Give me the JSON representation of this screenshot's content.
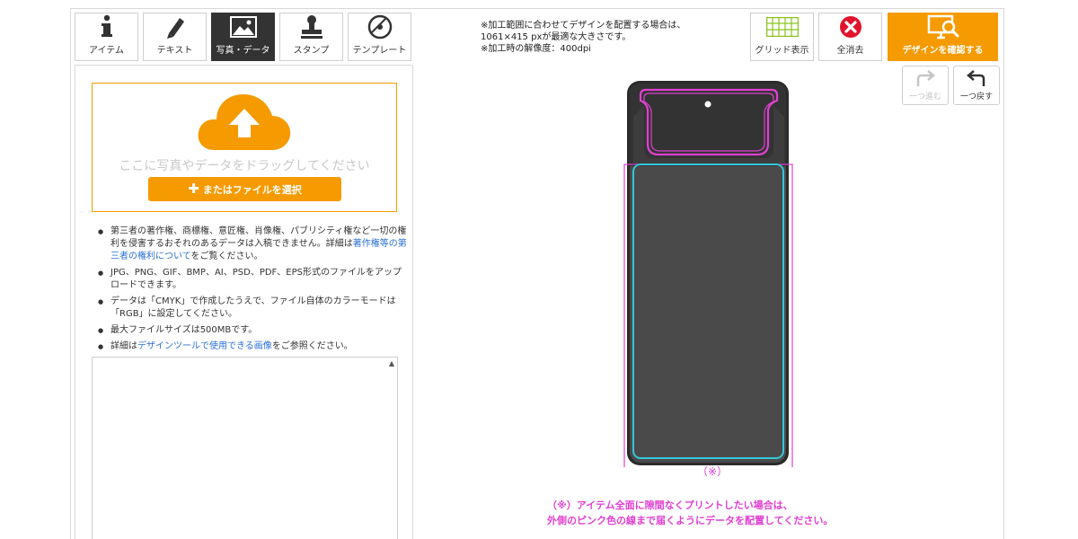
{
  "tabs": [
    {
      "label": "アイテム",
      "icon": "info-icon"
    },
    {
      "label": "テキスト",
      "icon": "pen-icon"
    },
    {
      "label": "写真・データ",
      "icon": "image-icon"
    },
    {
      "label": "スタンプ",
      "icon": "stamp-icon"
    },
    {
      "label": "テンプレート",
      "icon": "template-icon"
    }
  ],
  "upload": {
    "drop_text": "ここに写真やデータをドラッグしてください",
    "select_label": "またはファイルを選択"
  },
  "notes": {
    "n1_a": "第三者の著作権、商標権、意匠権、肖像権、パブリシティ権など一切の権利を侵害するおそれのあるデータは入稿できません。詳細は",
    "n1_link": "著作権等の第三者の権利について",
    "n1_b": "をご覧ください。",
    "n2": "JPG、PNG、GIF、BMP、AI、PSD、PDF、EPS形式のファイルをアップロードできます。",
    "n3": "データは「CMYK」で作成したうえで、ファイル自体のカラーモードは「RGB」に設定してください。",
    "n4": "最大ファイルサイズは500MBです。",
    "n5_a": "詳細は",
    "n5_link": "デザインツールで使用できる画像",
    "n5_b": "をご参照ください。"
  },
  "info": {
    "line1": "※加工範囲に合わせてデザインを配置する場合は、",
    "line2": "1061×415 pxが最適な大きさです。",
    "line3": "※加工時の解像度：400dpi"
  },
  "toolbar": {
    "grid_label": "グリッド表示",
    "clear_label": "全消去",
    "confirm_label": "デザインを確認する",
    "redo_label": "一つ進む",
    "undo_label": "一つ戻す"
  },
  "canvas": {
    "asterisk": "（※）",
    "warn_line1": "（※）アイテム全面に隙間なくプリントしたい場合は、",
    "warn_line2": "外側のピンク色の線まで届くようにデータを配置してください。"
  },
  "colors": {
    "accent": "#f59a00",
    "pink_guide": "#e040d0",
    "cyan_guide": "#33c7d6"
  }
}
